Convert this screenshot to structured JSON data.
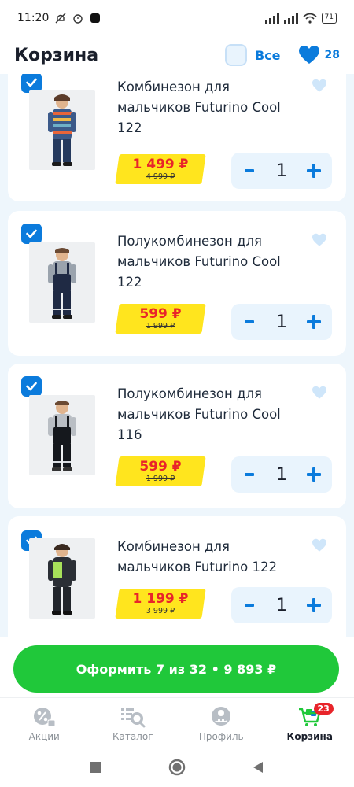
{
  "status_bar": {
    "time": "11:20",
    "battery": "71"
  },
  "header": {
    "title": "Корзина",
    "select_all_label": "Все",
    "favorites_count": "28"
  },
  "cart_items": [
    {
      "name": "Комбинезон для мальчиков Futurino Cool 122",
      "price": "1 499 ₽",
      "old_price": "4 999 ₽",
      "quantity": "1",
      "checked": true
    },
    {
      "name": "Полукомбинезон для мальчиков Futurino Cool 122",
      "price": "599 ₽",
      "old_price": "1 999 ₽",
      "quantity": "1",
      "checked": true
    },
    {
      "name": "Полукомбинезон для мальчиков Futurino Cool 116",
      "price": "599 ₽",
      "old_price": "1 999 ₽",
      "quantity": "1",
      "checked": true
    },
    {
      "name": "Комбинезон для мальчиков Futurino 122",
      "price": "1 199 ₽",
      "old_price": "3 999 ₽",
      "quantity": "1",
      "checked": true
    }
  ],
  "stepper": {
    "minus": "-",
    "plus": "+"
  },
  "checkout": {
    "label": "Оформить 7 из 32 • 9 893 ₽"
  },
  "tabbar": {
    "items": [
      {
        "label": "Акции",
        "icon": "percent-icon"
      },
      {
        "label": "Каталог",
        "icon": "catalog-search-icon"
      },
      {
        "label": "Профиль",
        "icon": "profile-icon"
      },
      {
        "label": "Корзина",
        "icon": "cart-icon",
        "badge": "23",
        "active": true
      }
    ]
  },
  "colors": {
    "accent_blue": "#0b7bdc",
    "checkout_green": "#20c83a",
    "price_red": "#e8242a",
    "price_yellow": "#ffe51e"
  }
}
